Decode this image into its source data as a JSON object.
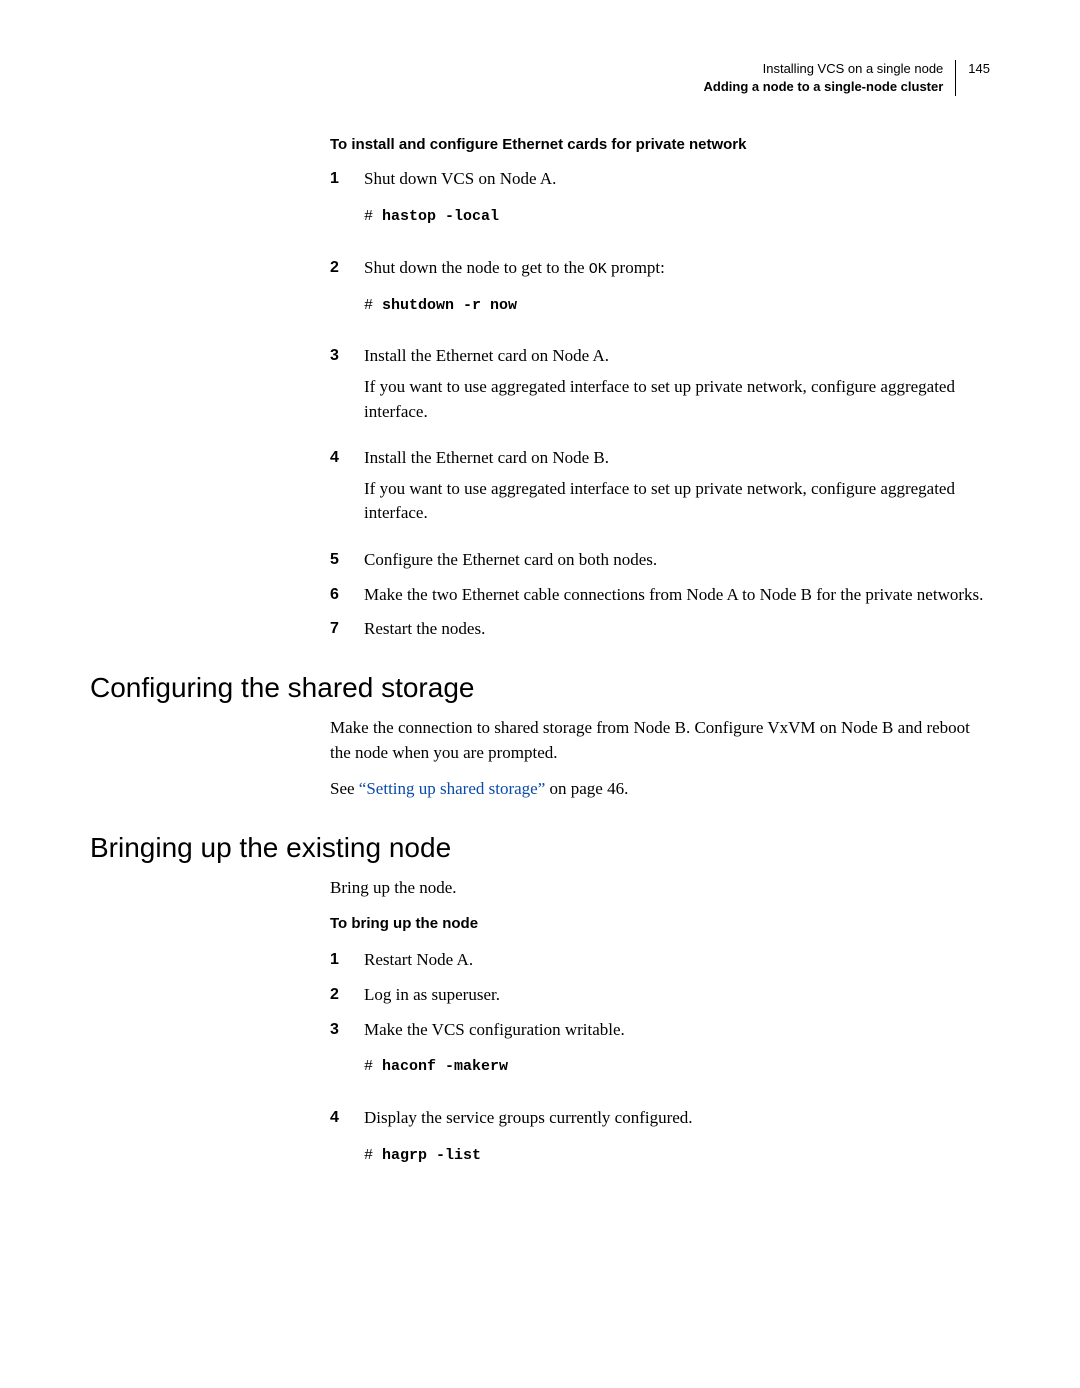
{
  "header": {
    "line1": "Installing VCS on a single node",
    "line2": "Adding a node to a single-node cluster",
    "pagenum": "145"
  },
  "proc1": {
    "title": "To install and configure Ethernet cards for private network",
    "steps": [
      {
        "num": "1",
        "text": "Shut down VCS on Node A.",
        "code_hash": "#",
        "code_cmd": "hastop -local"
      },
      {
        "num": "2",
        "text_pre": "Shut down the node to get to the ",
        "text_mono": "OK",
        "text_post": " prompt:",
        "code_hash": "#",
        "code_cmd": "shutdown -r now"
      },
      {
        "num": "3",
        "text": "Install the Ethernet card on Node A.",
        "para": "If you want to use aggregated interface to set up private network, configure aggregated interface."
      },
      {
        "num": "4",
        "text": "Install the Ethernet card on Node B.",
        "para": "If you want to use aggregated interface to set up private network, configure aggregated interface."
      },
      {
        "num": "5",
        "text": "Configure the Ethernet card on both nodes."
      },
      {
        "num": "6",
        "text": "Make the two Ethernet cable connections from Node A to Node B for the private networks."
      },
      {
        "num": "7",
        "text": "Restart the nodes."
      }
    ]
  },
  "section1": {
    "title": "Configuring the shared storage",
    "para1": "Make the connection to shared storage from Node B. Configure VxVM on Node B and reboot the node when you are prompted.",
    "see_pre": "See ",
    "see_link": "“Setting up shared storage”",
    "see_post": " on page 46."
  },
  "section2": {
    "title": "Bringing up the existing node",
    "intro": "Bring up the node.",
    "proc_title": "To bring up the node",
    "steps": [
      {
        "num": "1",
        "text": "Restart Node A."
      },
      {
        "num": "2",
        "text": "Log in as superuser."
      },
      {
        "num": "3",
        "text": "Make the VCS configuration writable.",
        "code_hash": "#",
        "code_cmd": "haconf -makerw"
      },
      {
        "num": "4",
        "text": "Display the service groups currently configured.",
        "code_hash": "#",
        "code_cmd": "hagrp -list"
      }
    ]
  }
}
